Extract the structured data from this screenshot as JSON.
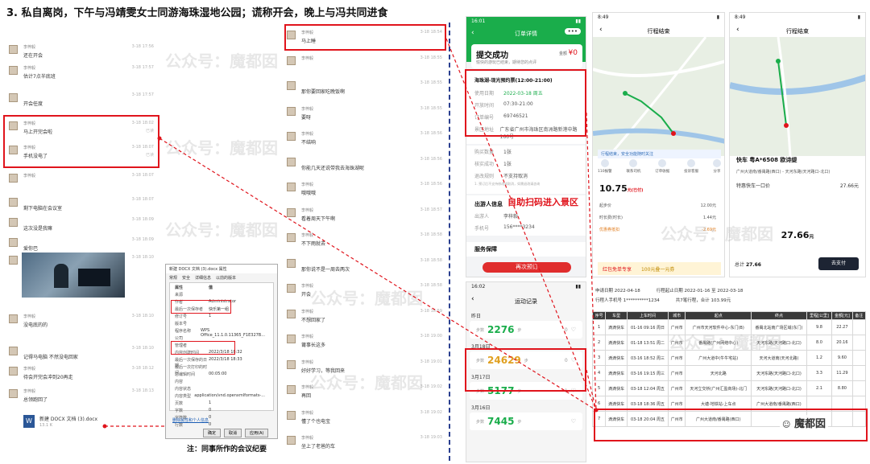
{
  "title": "3. 私自离岗，下午与冯靖雯女士同游海珠湿地公园；谎称开会，晚上与冯共同进食",
  "watermark": "公众号：魔都囡",
  "chat_left": {
    "messages": [
      {
        "name": "李梓毅",
        "text": "还在开会",
        "time": "3-18 17:56",
        "read": ""
      },
      {
        "name": "李梓毅",
        "text": "估计7点半底班",
        "time": "3-18 17:57",
        "read": ""
      },
      {
        "name": "",
        "text": "开会任度",
        "time": "3-18 17:57",
        "read": ""
      },
      {
        "name": "李梓毅",
        "text": "马上开完会啦",
        "time": "3-18 18:02",
        "read": "已读"
      },
      {
        "name": "李梓毅",
        "text": "手机没电了",
        "time": "3-18 18:07",
        "read": "已读"
      },
      {
        "name": "李梓毅",
        "text": "",
        "time": "3-18 18:07",
        "read": ""
      },
      {
        "name": "",
        "text": "剩下电脑在会议室",
        "time": "3-18 18:07",
        "read": ""
      },
      {
        "name": "",
        "text": "这次没是我嘛",
        "time": "3-18 18:09",
        "read": ""
      },
      {
        "name": "",
        "text": "爱你巴",
        "time": "3-18 18:09",
        "read": ""
      },
      {
        "name": "李梓毅",
        "text": "",
        "time": "3-18 18:10",
        "read": ""
      },
      {
        "name": "李梓毅",
        "text": "没电底的的",
        "time": "3-18 18:10",
        "read": ""
      },
      {
        "name": "",
        "text": "记得马电脑 不然没电回家",
        "time": "3-18 18:10",
        "read": ""
      },
      {
        "name": "李梓毅",
        "text": "待会开完会冲到20再走",
        "time": "3-18 18:12",
        "read": ""
      },
      {
        "name": "李梓毅",
        "text": "总领跑回了",
        "time": "3-18 18:13",
        "read": ""
      }
    ],
    "file": {
      "name": "新建 DOCX 文档 (3).docx",
      "size": "13.1 K"
    }
  },
  "chat_mid": {
    "messages": [
      {
        "name": "李梓毅",
        "text": "马上睡",
        "time": "3-18 18:54"
      },
      {
        "name": "李梓毅",
        "text": "",
        "time": "3-18 18:55"
      },
      {
        "name": "",
        "text": "那你要回家吃晚饭啊",
        "time": "3-18 18:55"
      },
      {
        "name": "李梓毅",
        "text": "要呀",
        "time": "3-18 18:55"
      },
      {
        "name": "李梓毅",
        "text": "不结响",
        "time": "3-18 18:56"
      },
      {
        "name": "",
        "text": "你能几天还说带我去海珠湖呢",
        "time": "3-18 18:56"
      },
      {
        "name": "李梓毅",
        "text": "哦哦哦",
        "time": "3-18 18:56"
      },
      {
        "name": "李梓毅",
        "text": "看着周天下午啊",
        "time": "3-18 18:57"
      },
      {
        "name": "李梓毅",
        "text": "不下雨就去",
        "time": "3-18 18:58"
      },
      {
        "name": "",
        "text": "那你说不是一周去两次",
        "time": "3-18 18:58"
      },
      {
        "name": "李梓毅",
        "text": "开会",
        "time": "3-18 18:58"
      },
      {
        "name": "李梓毅",
        "text": "不想回家了",
        "time": "3-18 18:59"
      },
      {
        "name": "李梓毅",
        "text": "莆事长这多",
        "time": "3-18 19:00"
      },
      {
        "name": "李梓毅",
        "text": "好好学习，等我回来",
        "time": "3-18 19:01"
      },
      {
        "name": "李梓毅",
        "text": "再回",
        "time": "3-18 19:02"
      },
      {
        "name": "李梓毅",
        "text": "懂了个也电宝",
        "time": "3-18 19:02"
      },
      {
        "name": "李梓毅",
        "text": "坐上了老爸的车",
        "time": "3-18 19:03"
      }
    ]
  },
  "properties": {
    "window_title": "新建 DOCX 文档 (3).docx 属性",
    "tabs": [
      "常规",
      "安全",
      "详细信息",
      "以前的版本"
    ],
    "col_headers": [
      "属性",
      "值"
    ],
    "section": "来源",
    "rows": [
      {
        "k": "作者",
        "v": "Administrator"
      },
      {
        "k": "最后一次保存者",
        "v": "快乐第一组"
      },
      {
        "k": "修订号",
        "v": "1"
      },
      {
        "k": "版本号",
        "v": ""
      },
      {
        "k": "程序名称",
        "v": "WPS Office_11.1.0.11365_F1E327B..."
      },
      {
        "k": "公司",
        "v": ""
      },
      {
        "k": "管理者",
        "v": ""
      },
      {
        "k": "内容创建时间",
        "v": "2022/3/18 18:32"
      },
      {
        "k": "最后一次保存的日期",
        "v": "2022/3/18 18:33"
      },
      {
        "k": "最后一次打印的时间",
        "v": ""
      },
      {
        "k": "总编辑时间",
        "v": "00:05:00"
      }
    ],
    "section2": "内容",
    "rows2": [
      {
        "k": "内容状态",
        "v": ""
      },
      {
        "k": "内容类型",
        "v": "application/vnd.openxmlformats-..."
      },
      {
        "k": "页数",
        "v": "1"
      },
      {
        "k": "字数",
        "v": "0"
      },
      {
        "k": "字符数",
        "v": "0"
      },
      {
        "k": "行数",
        "v": "0"
      }
    ],
    "remove_link": "删除属性和个人信息",
    "buttons": [
      "确定",
      "取消",
      "应用(A)"
    ]
  },
  "annot_note": "注：同事所作的会议纪要",
  "annot_scan": "自助扫码进入景区",
  "order": {
    "status_time": "16:01",
    "header": "订单详情",
    "success": "提交成功",
    "success_sub": "愉快的游玩已结束，期待您的点评",
    "amount_label": "金额",
    "amount": "¥0",
    "ticket": "海珠湖-现光预约票(12:00-21:00)",
    "fields": [
      {
        "k": "使用日期",
        "v": "2022-03-18   周五"
      },
      {
        "k": "开放时间",
        "v": "07:30-21:00"
      },
      {
        "k": "订单编号",
        "v": "69746521"
      },
      {
        "k": "景区地址",
        "v": "广东省广州市海珠区南洲路新港中路166号"
      }
    ],
    "extra": [
      {
        "k": "购买数量",
        "v": "1张"
      },
      {
        "k": "核实成功",
        "v": "1张"
      },
      {
        "k": "退改规则",
        "v": "不支持取消"
      }
    ],
    "tip": "1. 预订后不支持修改或取消，如需退改请咨询",
    "visitor_title": "出游人信息",
    "visitor": [
      {
        "k": "出游人",
        "v": "李梓毅"
      },
      {
        "k": "手机号",
        "v": "156****3234"
      }
    ],
    "service": "服务保障",
    "rebook": "再次预订"
  },
  "sport": {
    "status_time": "16:02",
    "header": "运动记录",
    "days": [
      {
        "date": "昨日",
        "steps": "2276",
        "likes": "0"
      },
      {
        "date": "3月18日",
        "steps": "24629",
        "likes": "0"
      },
      {
        "date": "3月17日",
        "steps": "5177",
        "likes": "1"
      },
      {
        "date": "3月16日",
        "steps": "7445",
        "likes": ""
      }
    ],
    "unit": "步",
    "steps_label": "步数"
  },
  "trip_a": {
    "time": "8:49",
    "header": "行程结束",
    "safety": "行程结束，安全功能随时关注",
    "actions": [
      "110报警",
      "联系司机",
      "订单收据",
      "投诉客服",
      "分享"
    ],
    "price": "10.75",
    "price_unit": "元(已付)",
    "fees": [
      {
        "k": "起步价",
        "v": "12.00元"
      },
      {
        "k": "时长费(时长)",
        "v": "1.44元"
      },
      {
        "k": "优惠券抵扣",
        "v": "-2.69元"
      }
    ],
    "promo": "红包免单专享",
    "promo_tag": "100元叠一元券",
    "banner": "出行不用愁"
  },
  "trip_b": {
    "time": "8:49",
    "header": "行程结束",
    "car": "快车 粤A*6508 欧诗缇",
    "route": "广州大道南/番禺路(西口) - 天河东路(天河路口-北口)",
    "item": "特惠快车一口价",
    "item_price": "27.66元",
    "total": "27.66",
    "total_unit": "元",
    "total_label": "总计",
    "pay_btn": "去支付"
  },
  "records": {
    "apply_date": "申请日期 2022-04-18",
    "trip_range": "行程起止日期 2022-01-16 至 2022-03-18",
    "phone": "行程人手机号 1**********1234",
    "summary": "共7笔行程，合计 103.99元",
    "headers": [
      "序号",
      "车型",
      "上车时间",
      "城市",
      "起点",
      "终点",
      "里程[公里]",
      "金额[元]",
      "备注"
    ],
    "rows": [
      [
        "1",
        "滴滴快车",
        "01-16 09:16 周日",
        "广州市",
        "广州市天河软件中心-东门(B)",
        "番禺北站南广场区域(东门)",
        "9.8",
        "22.27",
        ""
      ],
      [
        "2",
        "滴滴快车",
        "01-18 13:51 周二",
        "广州市",
        "番禺路(广州网络中心)",
        "天河东路(天河路口-北口)",
        "8.0",
        "20.16",
        ""
      ],
      [
        "3",
        "滴滴快车",
        "03-16 18:52 周三",
        "广州市",
        "广州大道中(牛牛宅站)",
        "天河大道南(天河北路)",
        "1.2",
        "9.60",
        ""
      ],
      [
        "4",
        "滴滴快车",
        "03-16 19:15 周三",
        "广州市",
        "天河北路",
        "天河东路(天河路口-北口)",
        "3.3",
        "11.29",
        ""
      ],
      [
        "5",
        "滴滴快车",
        "03-18 12:04 周五",
        "广州市",
        "天河立交桥(广州汇盈商场)-北门",
        "天河东路(天河路口-北口)",
        "2.1",
        "8.80",
        ""
      ],
      [
        "6",
        "滴滴快车",
        "03-18 18:36 周五",
        "广州市",
        "大塘-地铁站-上车点",
        "广州大道南/番禺路(西口)",
        "",
        "",
        ""
      ],
      [
        "7",
        "滴滴快车",
        "03-18 20:04 周五",
        "广州市",
        "广州大道南/番禺路(西口)",
        "",
        "",
        "",
        ""
      ]
    ]
  },
  "brand": "魔都囡",
  "accent": "#e0141c",
  "green": "#1aad4b"
}
